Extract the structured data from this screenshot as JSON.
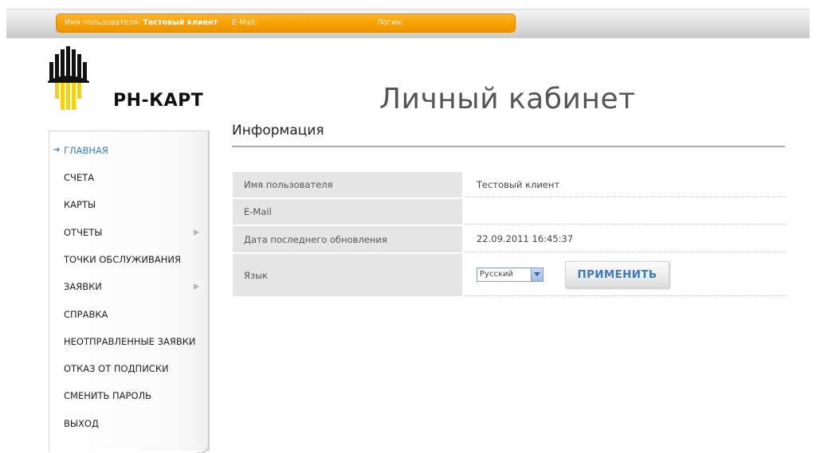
{
  "userbar": {
    "username_label": "Имя пользователя:",
    "username_value": "Тестовый клиент",
    "email_label": "E-Mail:",
    "login_label": "Логин:"
  },
  "logo": {
    "text": "РН-КАРТ",
    "colors": {
      "black": "#111111",
      "yellow": "#f6d300"
    }
  },
  "page_title": "Личный кабинет",
  "sidebar": {
    "items": [
      {
        "label": "ГЛАВНАЯ",
        "active": true,
        "bullet": "➔"
      },
      {
        "label": "СЧЕТА"
      },
      {
        "label": "КАРТЫ"
      },
      {
        "label": "ОТЧЕТЫ",
        "submenu": true
      },
      {
        "label": "ТОЧКИ ОБСЛУЖИВАНИЯ"
      },
      {
        "label": "ЗАЯВКИ",
        "submenu": true
      },
      {
        "label": "СПРАВКА"
      },
      {
        "label": "НЕОТПРАВЛЕННЫЕ ЗАЯВКИ"
      },
      {
        "label": "ОТКАЗ ОТ ПОДПИСКИ"
      },
      {
        "label": "СМЕНИТЬ ПАРОЛЬ"
      },
      {
        "label": "ВЫХОД"
      }
    ]
  },
  "info": {
    "title": "Информация",
    "rows": [
      {
        "key": "Имя пользователя",
        "value": "Тестовый клиент"
      },
      {
        "key": "E-Mail",
        "value": ""
      },
      {
        "key": "Дата последнего обновления",
        "value": "22.09.2011 16:45:37"
      },
      {
        "key": "Язык",
        "value": ""
      }
    ],
    "language_select": {
      "selected": "Русский"
    },
    "apply_label": "ПРИМЕНИТЬ"
  },
  "colors": {
    "accent_orange": "#f7a000",
    "accent_blue": "#3a7fc4"
  }
}
